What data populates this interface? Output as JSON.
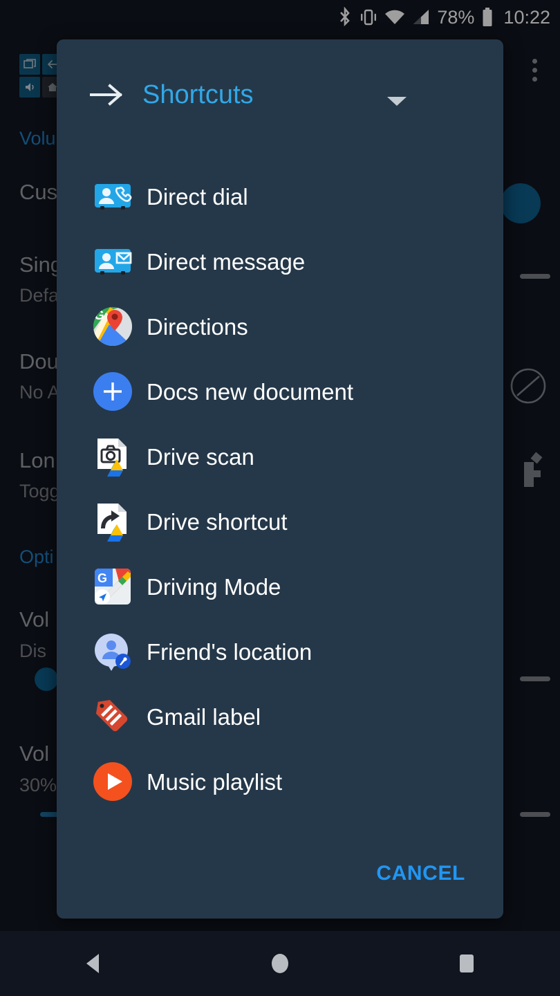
{
  "status_bar": {
    "battery_percent": "78%",
    "time": "10:22",
    "icons": [
      "bluetooth-icon",
      "vibrate-icon",
      "wifi-icon",
      "cell-signal-icon",
      "battery-icon"
    ]
  },
  "background_app": {
    "section_volume": "Volu",
    "items": [
      {
        "title": "Cus",
        "subtitle": ""
      },
      {
        "title": "Sing",
        "subtitle": "Defa"
      },
      {
        "title": "Dou",
        "subtitle": "No A"
      },
      {
        "title": "Lon",
        "subtitle": "Togg"
      }
    ],
    "section_options": "Opti",
    "options": [
      {
        "title": "Vol",
        "subtitle": "Dis"
      },
      {
        "title": "Vol",
        "subtitle": "30%"
      }
    ],
    "overflow_menu": "overflow-menu-icon"
  },
  "dialog": {
    "title": "Shortcuts",
    "back_icon": "arrow-right-icon",
    "dropdown_icon": "chevron-down-icon",
    "cancel_label": "CANCEL",
    "items": [
      {
        "label": "Direct dial",
        "icon": "contacts-phone-icon"
      },
      {
        "label": "Direct message",
        "icon": "contacts-message-icon"
      },
      {
        "label": "Directions",
        "icon": "google-maps-icon"
      },
      {
        "label": "Docs new document",
        "icon": "plus-circle-icon"
      },
      {
        "label": "Drive scan",
        "icon": "drive-scan-icon"
      },
      {
        "label": "Drive shortcut",
        "icon": "drive-shortcut-icon"
      },
      {
        "label": "Driving Mode",
        "icon": "driving-mode-icon"
      },
      {
        "label": "Friend's location",
        "icon": "friend-location-icon"
      },
      {
        "label": "Gmail label",
        "icon": "gmail-label-icon"
      },
      {
        "label": "Music playlist",
        "icon": "music-play-icon"
      }
    ]
  },
  "nav_bar": {
    "back": "nav-back-icon",
    "home": "nav-home-icon",
    "recents": "nav-recents-icon"
  },
  "colors": {
    "accent_blue": "#31a8e8",
    "cancel_blue": "#2196f3",
    "dialog_bg": "#253849",
    "page_bg": "#11151f"
  }
}
